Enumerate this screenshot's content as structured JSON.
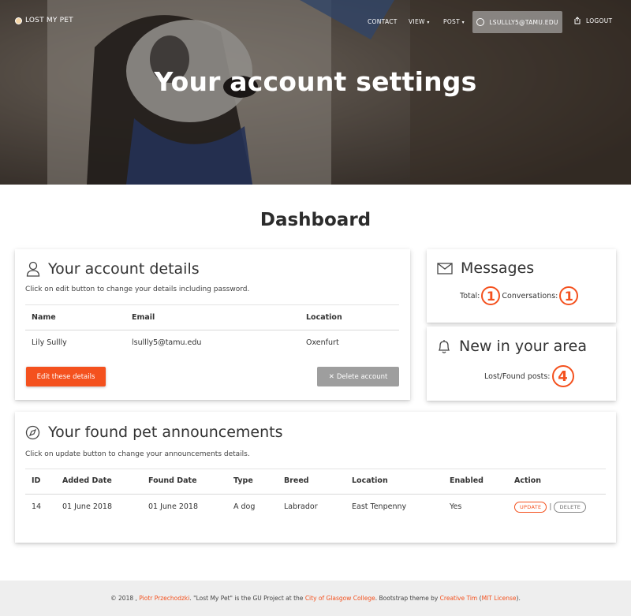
{
  "navbar": {
    "brand": "LOST MY PET",
    "contact": "CONTACT",
    "view": "VIEW",
    "post": "POST",
    "user": "LSULLLY5@TAMU.EDU",
    "logout": "LOGOUT"
  },
  "hero": {
    "title": "Your account settings"
  },
  "dashboard": {
    "title": "Dashboard"
  },
  "account": {
    "title": "Your account details",
    "subtitle": "Click on edit button to change your details including password.",
    "headers": [
      "Name",
      "Email",
      "Location"
    ],
    "row": [
      "Lily Sullly",
      "lsullly5@tamu.edu",
      "Oxenfurt"
    ],
    "edit_label": "Edit these details",
    "delete_label": "Delete account"
  },
  "messages": {
    "title": "Messages",
    "total_label": "Total:",
    "total_value": "1",
    "conv_label": "Conversations:",
    "conv_value": "1"
  },
  "area": {
    "title": "New in your area",
    "posts_label": "Lost/Found posts:",
    "posts_value": "4"
  },
  "found": {
    "title": "Your found pet announcements",
    "subtitle": "Click on update button to change your announcements details.",
    "headers": [
      "ID",
      "Added Date",
      "Found Date",
      "Type",
      "Breed",
      "Location",
      "Enabled",
      "Action"
    ],
    "rows": [
      [
        "14",
        "01 June 2018",
        "01 June 2018",
        "A dog",
        "Labrador",
        "East Tenpenny",
        "Yes"
      ]
    ],
    "update_label": "UPDATE",
    "separator": "|",
    "delete_label": "DELETE"
  },
  "footer": {
    "prefix": "© 2018 ,",
    "author": "Piotr Przechodzki",
    "middle": ". \"Lost My Pet\" is the GU Project at the",
    "college": "City of Glasgow College",
    "theme_text": ". Bootstrap theme by",
    "theme_author": "Creative Tim",
    "license_open": "(",
    "license": "MIT License",
    "license_close": ")."
  },
  "colors": {
    "accent": "#f4511e",
    "grey_button": "#9e9e9e",
    "footer_bg": "#eeeeee"
  }
}
